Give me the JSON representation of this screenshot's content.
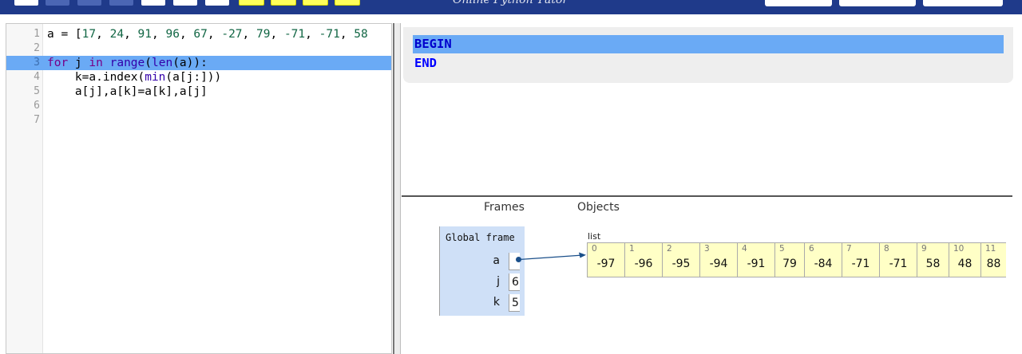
{
  "header": {
    "brand": "Online Python Tutor"
  },
  "colors": {
    "toolbar": "#1f3a8a",
    "highlight": "#6aaaf5",
    "frame_bg": "#cfe0f7",
    "list_bg": "#ffffc6",
    "output_text": "#0000ff"
  },
  "editor": {
    "active_line": 3,
    "lines": [
      {
        "num": "1",
        "html": "a = [<span class=\"num\">17</span>, <span class=\"num\">24</span>, <span class=\"num\">91</span>, <span class=\"num\">96</span>, <span class=\"num\">67</span>, <span class=\"num\">-27</span>, <span class=\"num\">79</span>, <span class=\"num\">-71</span>, <span class=\"num\">-71</span>, <span class=\"num\">58</span>"
      },
      {
        "num": "2",
        "html": ""
      },
      {
        "num": "3",
        "html": "<span class=\"kw\">for</span> j <span class=\"kw\">in</span> <span class=\"bi\">range</span>(<span class=\"bi\">len</span>(a)):"
      },
      {
        "num": "4",
        "html": "    k=a.index(<span class=\"bi\">min</span>(a[j:]))"
      },
      {
        "num": "5",
        "html": "    a[j],a[k]=a[k],a[j]"
      },
      {
        "num": "6",
        "html": ""
      },
      {
        "num": "7",
        "html": ""
      }
    ]
  },
  "output": {
    "lines": [
      "BEGIN",
      "END"
    ],
    "highlighted_index": 0
  },
  "visualization": {
    "frames_heading": "Frames",
    "objects_heading": "Objects",
    "global_frame": {
      "title": "Global frame",
      "vars": [
        {
          "name": "a",
          "value": "",
          "pointer": true
        },
        {
          "name": "j",
          "value": "6",
          "pointer": false
        },
        {
          "name": "k",
          "value": "5",
          "pointer": false
        }
      ]
    },
    "list": {
      "label": "list",
      "indices": [
        "0",
        "1",
        "2",
        "3",
        "4",
        "5",
        "6",
        "7",
        "8",
        "9",
        "10",
        "11"
      ],
      "values": [
        "-97",
        "-96",
        "-95",
        "-94",
        "-91",
        "79",
        "-84",
        "-71",
        "-71",
        "58",
        "48",
        "88"
      ]
    }
  }
}
